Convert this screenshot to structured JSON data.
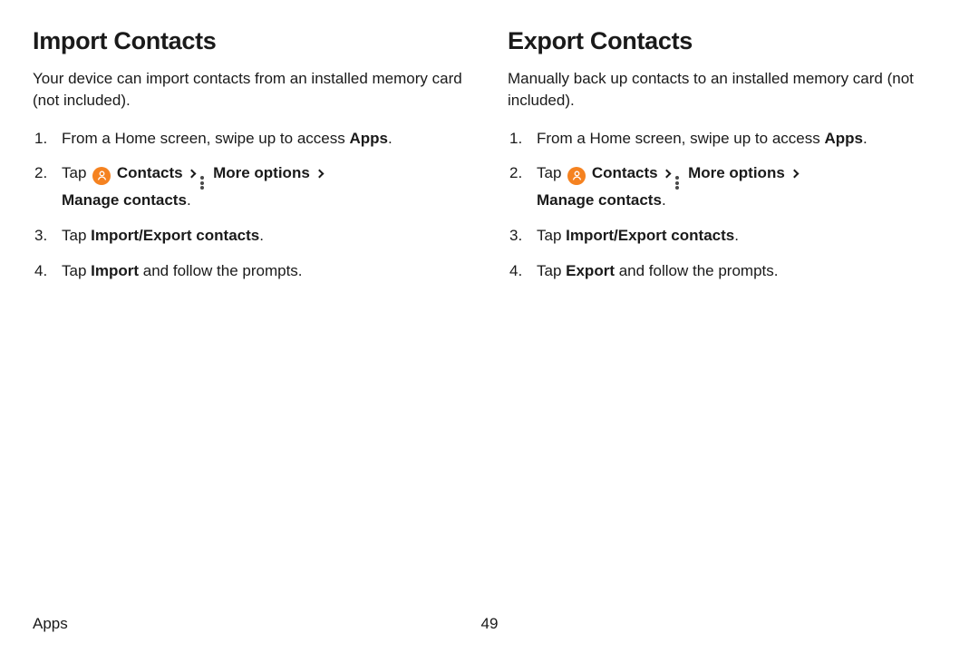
{
  "left": {
    "heading": "Import Contacts",
    "intro": "Your device can import contacts from an installed memory card (not included).",
    "step1_a": "From a Home screen, swipe up to access ",
    "step1_b": "Apps",
    "step2_tap": "Tap ",
    "step2_contacts": " Contacts",
    "step2_more": " More options",
    "step2_manage": "Manage contacts",
    "step3_a": "Tap ",
    "step3_b": "Import/Export contacts",
    "step4_a": "Tap ",
    "step4_b": "Import",
    "step4_c": " and follow the prompts."
  },
  "right": {
    "heading": "Export Contacts",
    "intro": "Manually back up contacts to an installed memory card (not included).",
    "step1_a": "From a Home screen, swipe up to access ",
    "step1_b": "Apps",
    "step2_tap": "Tap ",
    "step2_contacts": " Contacts",
    "step2_more": " More options",
    "step2_manage": "Manage contacts",
    "step3_a": "Tap ",
    "step3_b": "Import/Export contacts",
    "step4_a": "Tap ",
    "step4_b": "Export",
    "step4_c": " and follow the prompts."
  },
  "footer": {
    "section": "Apps",
    "page": "49"
  }
}
